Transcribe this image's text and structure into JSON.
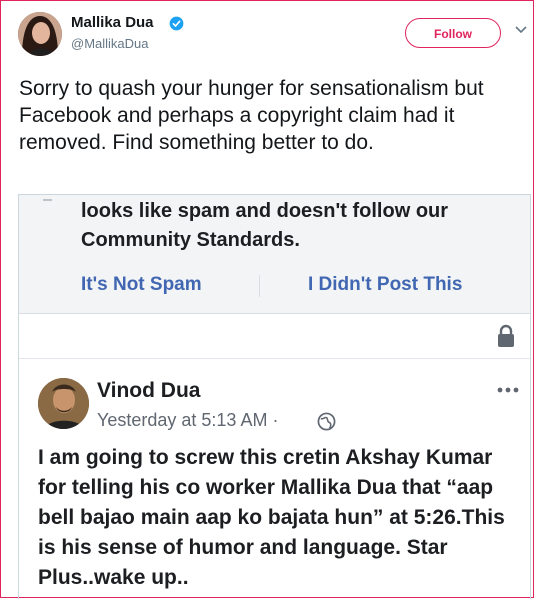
{
  "tweet": {
    "author_name": "Mallika Dua",
    "author_handle": "@MallikaDua",
    "follow_label": "Follow",
    "text": "Sorry to quash your hunger for sensationalism but Facebook and perhaps a copyright claim had it removed. Find something better to do."
  },
  "screenshot": {
    "spam_notice": "looks like spam and doesn't follow our Community Standards.",
    "not_spam_label": "It's Not Spam",
    "didnt_post_label": "I Didn't Post This",
    "post": {
      "author": "Vinod Dua",
      "timestamp": "Yesterday at 5:13 AM",
      "separator": "·",
      "text": "I am going to screw this cretin Akshay Kumar for telling his co worker Mallika Dua that “aap bell bajao main aap ko bajata hun” at 5:26.This is his sense of humor and language. Star Plus..wake up.."
    }
  },
  "colors": {
    "follow_accent": "#e0245e",
    "verified_blue": "#1da1f2",
    "facebook_link": "#4267b2"
  },
  "icons": [
    "verified-badge-icon",
    "chevron-down-icon",
    "lock-icon",
    "globe-icon",
    "more-options-icon"
  ]
}
